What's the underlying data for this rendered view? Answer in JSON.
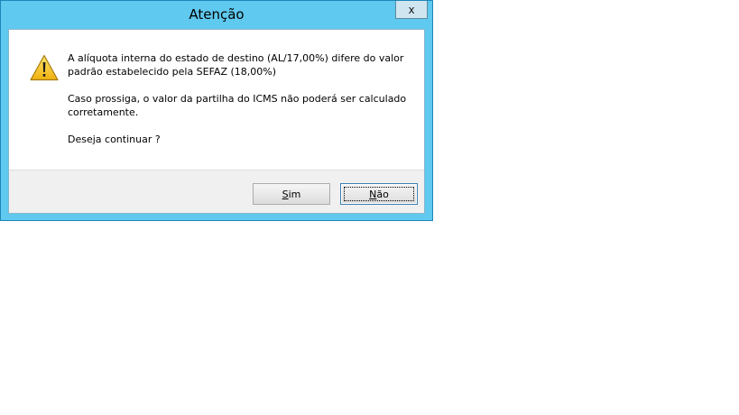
{
  "dialog": {
    "title": "Atenção",
    "close_glyph": "x",
    "icon": "warning-icon",
    "messages": [
      "A alíquota interna do estado de destino (AL/17,00%) difere do valor\npadrão estabelecido pela SEFAZ (18,00%)",
      "Caso prossiga, o valor da partilha do ICMS não poderá ser calculado\ncorretamente.",
      "Deseja continuar ?"
    ],
    "buttons": {
      "yes": {
        "accel": "S",
        "rest": "im"
      },
      "no": {
        "accel": "N",
        "rest": "ão",
        "focused": true
      }
    }
  },
  "colors": {
    "frame": "#5fc9ef",
    "frame_border": "#1e86b8",
    "footer": "#f0f0f0",
    "warning_fill": "#f8c62b"
  }
}
